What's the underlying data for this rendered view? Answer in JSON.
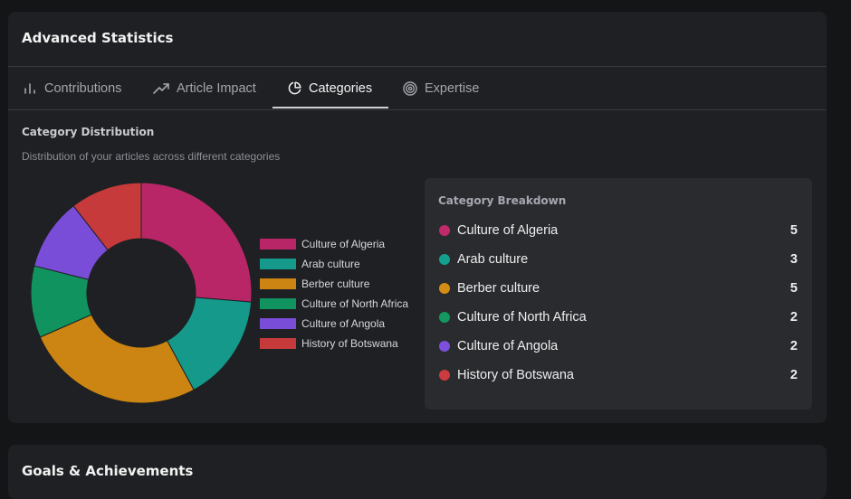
{
  "stats_card": {
    "title": "Advanced Statistics"
  },
  "tabs": [
    {
      "label": "Contributions",
      "icon": "bar-chart-icon"
    },
    {
      "label": "Article Impact",
      "icon": "trending-up-icon"
    },
    {
      "label": "Categories",
      "icon": "pie-chart-icon",
      "active": true
    },
    {
      "label": "Expertise",
      "icon": "target-icon"
    }
  ],
  "section": {
    "title": "Category Distribution",
    "subtitle": "Distribution of your articles across different categories"
  },
  "chart_data": {
    "type": "pie",
    "donut": true,
    "categories": [
      "Culture of Algeria",
      "Arab culture",
      "Berber culture",
      "Culture of North Africa",
      "Culture of Angola",
      "History of Botswana"
    ],
    "values": [
      5,
      3,
      5,
      2,
      2,
      2
    ],
    "colors": [
      "#b82667",
      "#14998a",
      "#cc8512",
      "#11935f",
      "#7a4dd8",
      "#c63a3c"
    ],
    "legend_position": "right"
  },
  "breakdown": {
    "title": "Category Breakdown",
    "items": [
      {
        "label": "Culture of Algeria",
        "count": "5",
        "color": "#c02a6a"
      },
      {
        "label": "Arab culture",
        "count": "3",
        "color": "#14a08f"
      },
      {
        "label": "Berber culture",
        "count": "5",
        "color": "#d28d14"
      },
      {
        "label": "Culture of North Africa",
        "count": "2",
        "color": "#13995f"
      },
      {
        "label": "Culture of Angola",
        "count": "2",
        "color": "#7c50dc"
      },
      {
        "label": "History of Botswana",
        "count": "2",
        "color": "#cc3b3e"
      }
    ]
  },
  "goals_card": {
    "title": "Goals & Achievements"
  }
}
